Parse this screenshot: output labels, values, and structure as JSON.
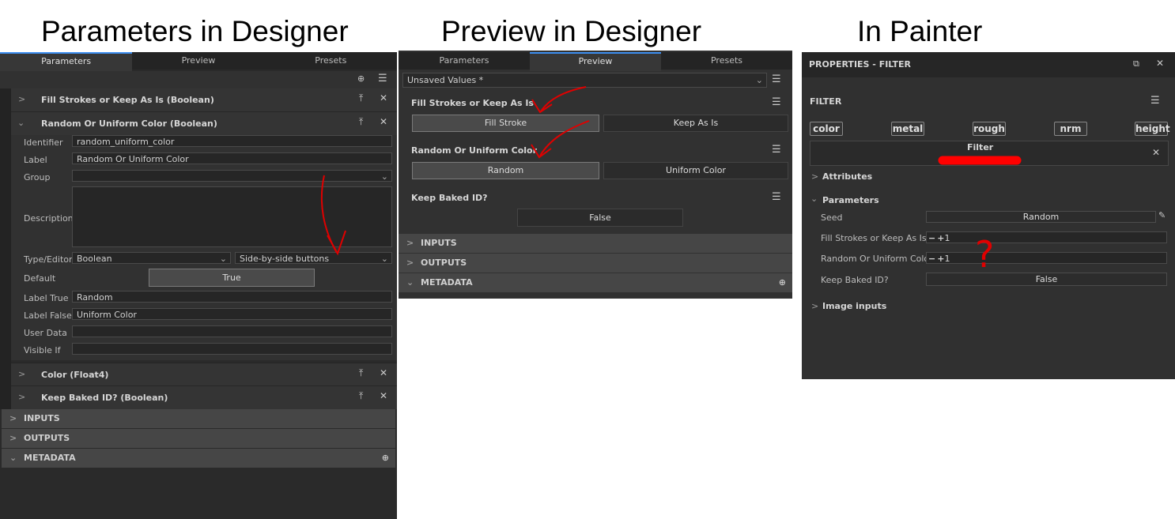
{
  "headings": {
    "designer_params": "Parameters in Designer",
    "designer_preview": "Preview in Designer",
    "painter": "In Painter"
  },
  "designer_params": {
    "tabs": [
      "Parameters",
      "Preview",
      "Presets"
    ],
    "params": [
      {
        "title": "Fill Strokes or Keep As Is (Boolean)"
      },
      {
        "title": "Random Or Uniform Color (Boolean)"
      },
      {
        "title": "Color (Float4)"
      },
      {
        "title": "Keep Baked ID? (Boolean)"
      }
    ],
    "form": {
      "identifier_label": "Identifier",
      "identifier_value": "random_uniform_color",
      "label_label": "Label",
      "label_value": "Random Or Uniform Color",
      "group_label": "Group",
      "group_value": "",
      "description_label": "Description",
      "type_label": "Type/Editor",
      "type_value": "Boolean",
      "editor_value": "Side-by-side buttons",
      "default_label": "Default",
      "default_value": "True",
      "label_true_label": "Label True",
      "label_true_value": "Random",
      "label_false_label": "Label False",
      "label_false_value": "Uniform Color",
      "user_data_label": "User Data",
      "user_data_value": "",
      "visible_if_label": "Visible If",
      "visible_if_value": ""
    },
    "sections": [
      "INPUTS",
      "OUTPUTS",
      "METADATA"
    ]
  },
  "designer_preview": {
    "tabs": [
      "Parameters",
      "Preview",
      "Presets"
    ],
    "preset_value": "Unsaved Values *",
    "fill": {
      "title": "Fill Strokes or Keep As Is",
      "option_a": "Fill Stroke",
      "option_b": "Keep As Is"
    },
    "random": {
      "title": "Random Or Uniform Color",
      "option_a": "Random",
      "option_b": "Uniform Color"
    },
    "baked": {
      "title": "Keep Baked ID?",
      "value": "False"
    },
    "sections": [
      "INPUTS",
      "OUTPUTS",
      "METADATA"
    ]
  },
  "painter": {
    "title": "PROPERTIES - FILTER",
    "section": "FILTER",
    "channels": [
      "color",
      "metal",
      "rough",
      "nrm",
      "height"
    ],
    "filter_name": "Filter",
    "attributes": "Attributes",
    "parameters": "Parameters",
    "seed_label": "Seed",
    "seed_value": "Random",
    "fill_label": "Fill Strokes or Keep As Is",
    "fill_value": "1",
    "random_label": "Random Or Uniform Color",
    "random_value": "1",
    "baked_label": "Keep Baked ID?",
    "baked_value": "False",
    "image_inputs": "Image inputs"
  },
  "annotation_text": "?",
  "colors": {
    "accent": "#3d8ef0",
    "annotation": "#e00000",
    "panel_bg": "#313131"
  }
}
